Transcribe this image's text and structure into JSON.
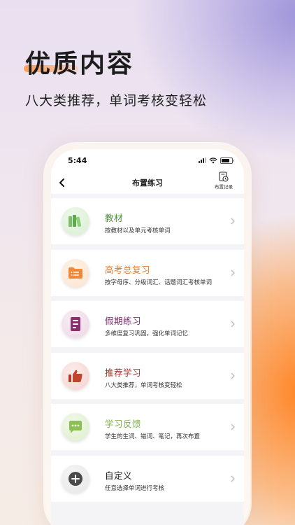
{
  "hero": {
    "title": "优质内容",
    "subtitle": "八大类推荐，单词考核变轻松"
  },
  "status_bar": {
    "time": "5:44",
    "battery_level": 0.8
  },
  "nav": {
    "title": "布置练习",
    "history_label": "布置记录"
  },
  "items": [
    {
      "title": "教材",
      "desc": "按教材以及单元考核单词",
      "title_color": "#4a8a3a",
      "icon": "books-icon"
    },
    {
      "title": "高考总复习",
      "desc": "按字母序、分级词汇、话题词汇考核单词",
      "title_color": "#e07c2a",
      "icon": "folder-icon"
    },
    {
      "title": "假期练习",
      "desc": "多维度复习巩固，强化单词记忆",
      "title_color": "#7a2e6a",
      "icon": "document-icon"
    },
    {
      "title": "推荐学习",
      "desc": "八大类推荐，单词考核变轻松",
      "title_color": "#a03528",
      "icon": "thumbs-up-icon"
    },
    {
      "title": "学习反馈",
      "desc": "学生的生词、错词、笔记，再次布置",
      "title_color": "#7fb24a",
      "icon": "chat-icon"
    },
    {
      "title": "自定义",
      "desc": "任意选择单词进行考核",
      "title_color": "#1a1a1a",
      "icon": "plus-icon"
    }
  ],
  "colors": {
    "accent_orange": "#ff8a1f",
    "accent_purple": "#9b8fd8"
  }
}
